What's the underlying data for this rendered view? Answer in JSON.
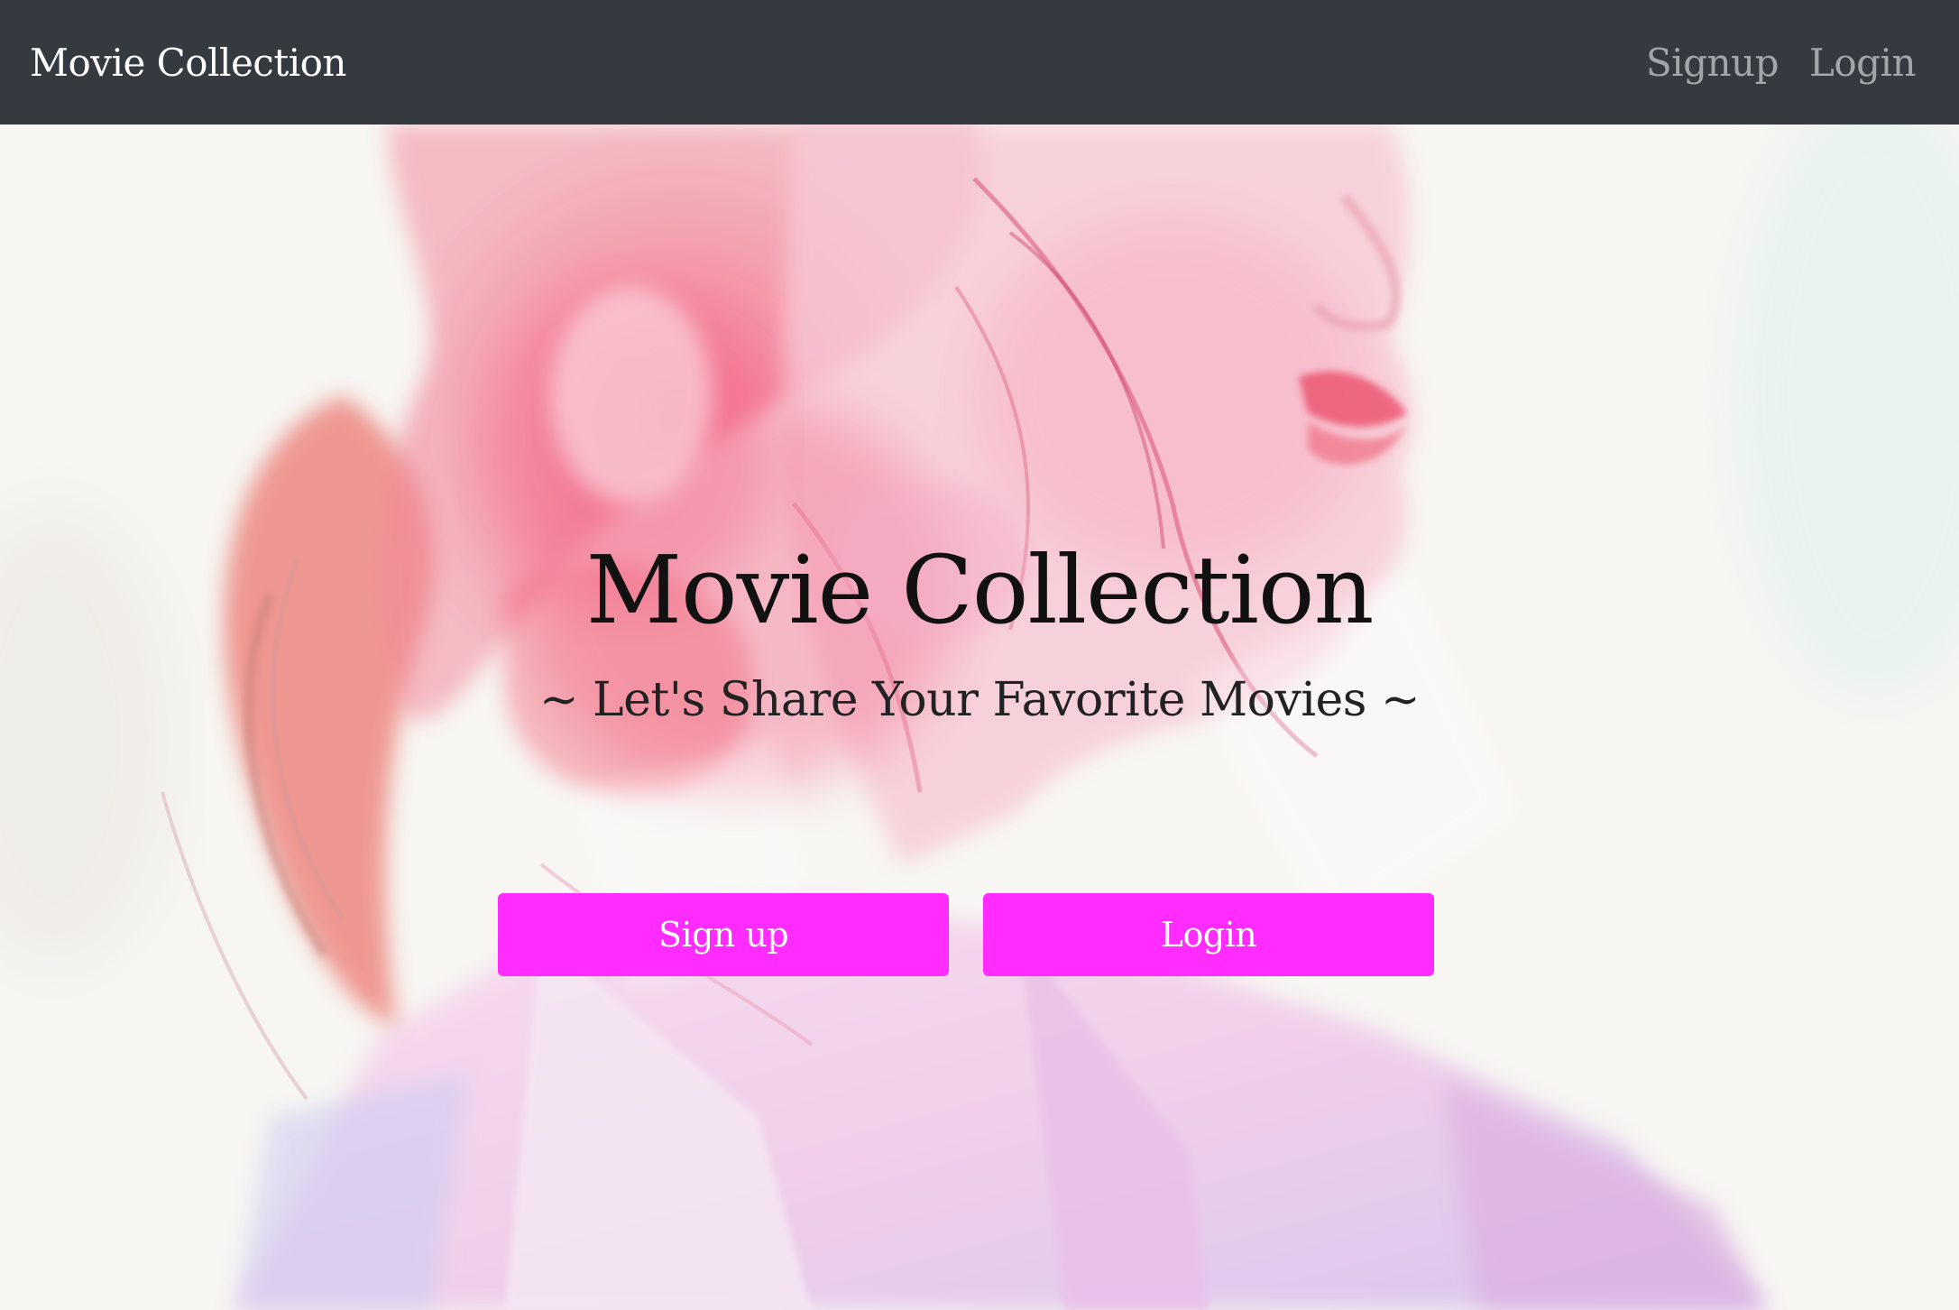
{
  "navbar": {
    "brand": "Movie Collection",
    "links": [
      {
        "label": "Signup"
      },
      {
        "label": "Login"
      }
    ],
    "background_color": "#343a40"
  },
  "hero": {
    "title": "Movie Collection",
    "subtitle": "~ Let's Share Your Favorite Movies ~",
    "background_image": "double-exposure-portrait-pink",
    "buttons": {
      "signup_label": "Sign up",
      "login_label": "Login"
    },
    "button_color": "#ff2bff"
  }
}
